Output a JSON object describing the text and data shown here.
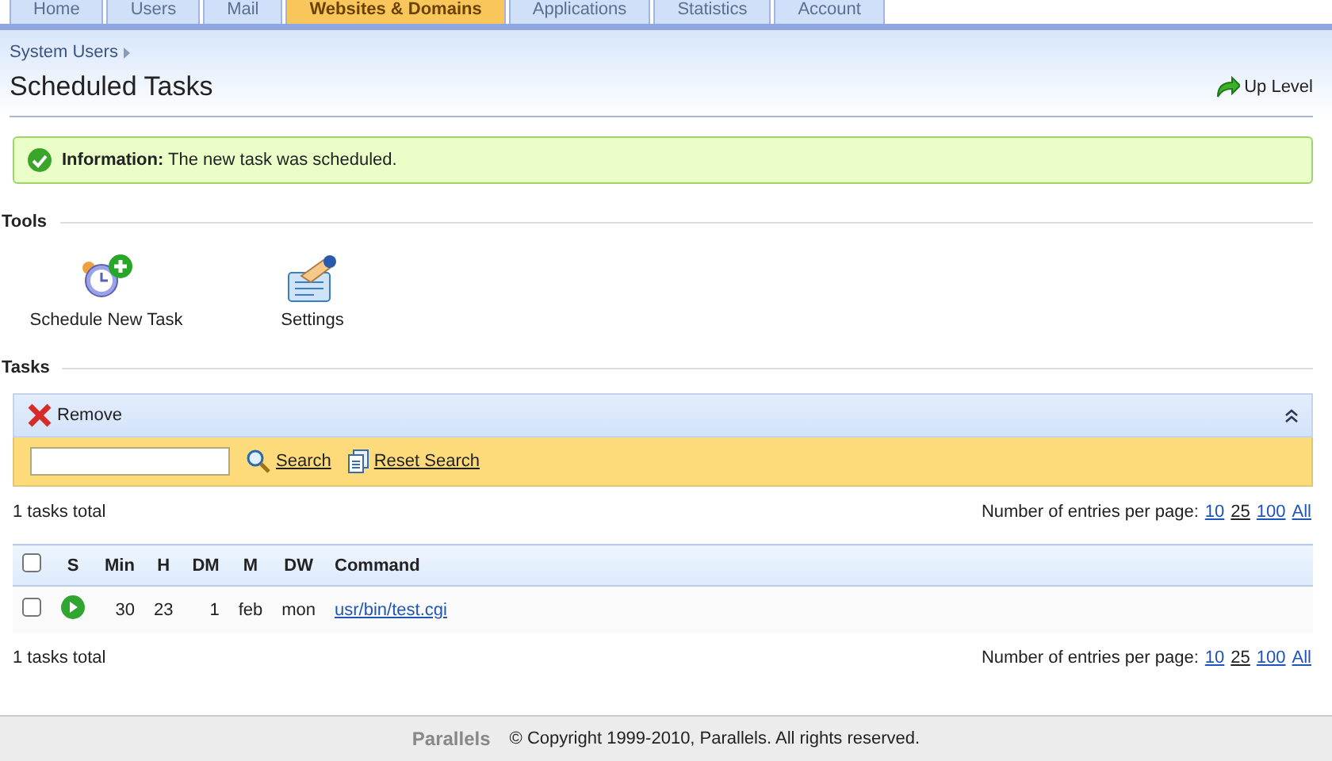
{
  "tabs": [
    {
      "label": "Home",
      "selected": false
    },
    {
      "label": "Users",
      "selected": false
    },
    {
      "label": "Mail",
      "selected": false
    },
    {
      "label": "Websites & Domains",
      "selected": true
    },
    {
      "label": "Applications",
      "selected": false
    },
    {
      "label": "Statistics",
      "selected": false
    },
    {
      "label": "Account",
      "selected": false
    }
  ],
  "breadcrumb": [
    "System Users"
  ],
  "page_title": "Scheduled Tasks",
  "up_level": "Up Level",
  "message": {
    "kind": "info",
    "text": "**Information:** The new task was scheduled."
  },
  "tools": {
    "heading": "Tools",
    "items": [
      {
        "kind": "schedule",
        "label": "Schedule New Task"
      },
      {
        "kind": "settings",
        "label": "Settings"
      }
    ]
  },
  "tasks": {
    "heading": "Tasks",
    "remove": "Remove",
    "collapsed": false,
    "search": {
      "search_link": "Search",
      "reset_link": "Reset Search"
    },
    "pagers": [
      {
        "total": "1 tasks total",
        "per_page_label": "Number of entries per page:",
        "per_page": [
          {
            "label": "10",
            "selected": false
          },
          {
            "label": "25",
            "selected": true
          },
          {
            "label": "100",
            "selected": false
          },
          {
            "label": "All",
            "selected": false
          }
        ]
      },
      {
        "total": "1 tasks total",
        "per_page_label": "Number of entries per page:",
        "per_page": [
          {
            "label": "10",
            "selected": false
          },
          {
            "label": "25",
            "selected": true
          },
          {
            "label": "100",
            "selected": false
          },
          {
            "label": "All",
            "selected": false
          }
        ]
      }
    ],
    "select_all_checked": false,
    "columns": [
      "S",
      "Min",
      "H",
      "DM",
      "M",
      "DW",
      "Command"
    ],
    "rows": [
      {
        "checked": false,
        "active": true,
        "min": "30",
        "h": "23",
        "dm": "1",
        "m": "feb",
        "dw": "mon",
        "command": "usr/bin/test.cgi"
      }
    ]
  },
  "footer": {
    "logo": "Parallels",
    "copyright": "© Copyright 1999-2010, Parallels. All rights reserved."
  }
}
